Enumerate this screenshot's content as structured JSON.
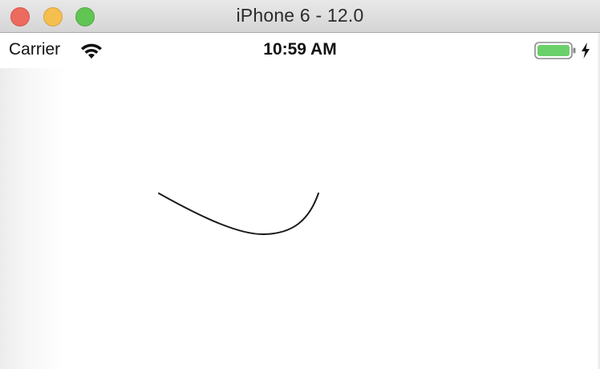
{
  "window": {
    "title": "iPhone 6 - 12.0",
    "buttons": {
      "close_color": "#ed6a5e",
      "minimize_color": "#f5bf4f",
      "zoom_color": "#61c554"
    }
  },
  "statusbar": {
    "carrier": "Carrier",
    "time": "10:59 AM",
    "wifi_icon": "wifi-icon",
    "battery_icon": "battery-full-icon",
    "charging_icon": "lightning-bolt-icon",
    "battery_color": "#6ad16a"
  },
  "canvas": {
    "stroke_color": "#1a1a1a",
    "content": "drawn curve"
  }
}
